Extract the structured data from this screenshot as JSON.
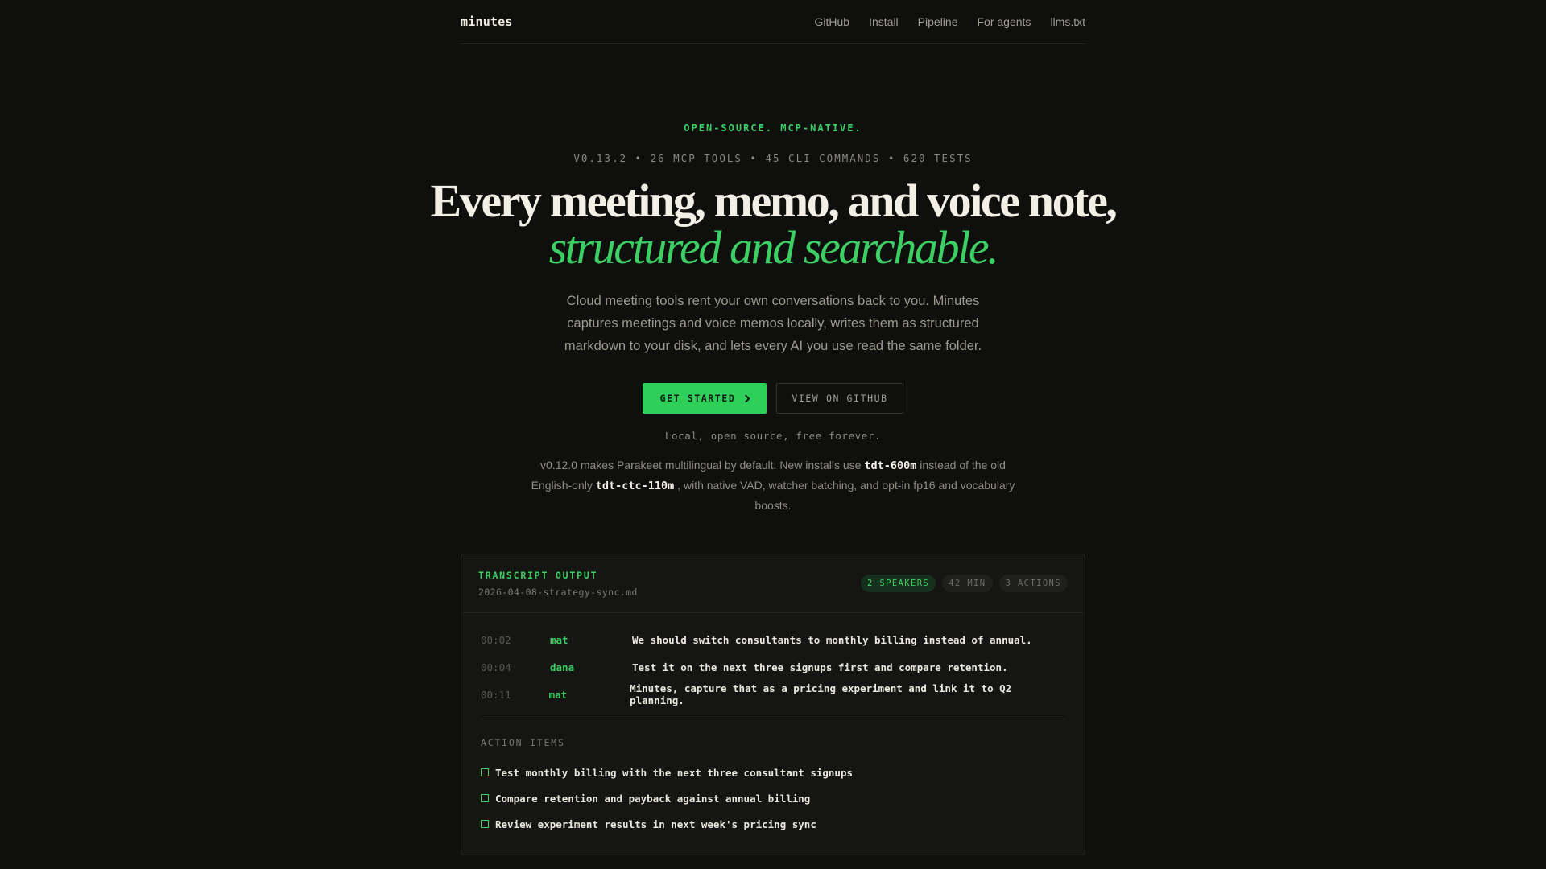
{
  "header": {
    "brand": "minutes",
    "nav": [
      "GitHub",
      "Install",
      "Pipeline",
      "For agents",
      "llms.txt"
    ]
  },
  "hero": {
    "eyebrow": "OPEN-SOURCE. MCP-NATIVE.",
    "stats": "V0.13.2 • 26 MCP TOOLS • 45 CLI COMMANDS • 620 TESTS",
    "headline": "Every meeting, memo, and voice note,",
    "headline_accent": "structured and searchable.",
    "lede": "Cloud meeting tools rent your own conversations back to you. Minutes captures meetings and voice memos locally, writes them as structured markdown to your disk, and lets every AI you use read the same folder.",
    "cta_primary": "GET STARTED",
    "cta_secondary": "VIEW ON GITHUB",
    "tagline": "Local, open source, free forever.",
    "note": {
      "p1": "v0.12.0 makes Parakeet multilingual by default. New installs use ",
      "code1": "tdt-600m",
      "p2": " instead of the old English-only ",
      "code2": "tdt-ctc-110m",
      "p3": " , with native VAD, watcher batching, and opt-in fp16 and vocabulary boosts."
    }
  },
  "transcript": {
    "title": "TRANSCRIPT OUTPUT",
    "file": "2026-04-08-strategy-sync.md",
    "badges": [
      "2 SPEAKERS",
      "42 MIN",
      "3 ACTIONS"
    ],
    "rows": [
      {
        "time": "00:02",
        "speaker": "mat",
        "text": "We should switch consultants to monthly billing instead of annual."
      },
      {
        "time": "00:04",
        "speaker": "dana",
        "text": "Test it on the next three signups first and compare retention."
      },
      {
        "time": "00:11",
        "speaker": "mat",
        "text": "Minutes, capture that as a pricing experiment and link it to Q2 planning."
      }
    ],
    "action_label": "ACTION ITEMS",
    "actions": [
      "Test monthly billing with the next three consultant signups",
      "Compare retention and payback against annual billing",
      "Review experiment results in next week's pricing sync"
    ]
  },
  "colors": {
    "background": "#0f0f0e",
    "accent": "#3ccf63",
    "button": "#2fd05a"
  }
}
